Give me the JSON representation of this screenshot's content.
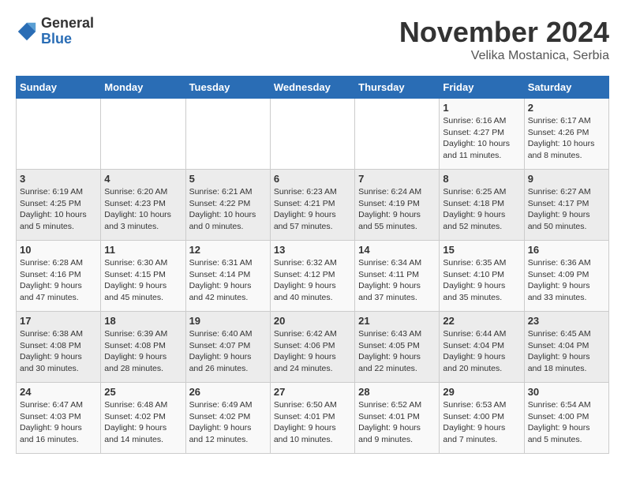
{
  "header": {
    "logo_general": "General",
    "logo_blue": "Blue",
    "month_title": "November 2024",
    "location": "Velika Mostanica, Serbia"
  },
  "weekdays": [
    "Sunday",
    "Monday",
    "Tuesday",
    "Wednesday",
    "Thursday",
    "Friday",
    "Saturday"
  ],
  "weeks": [
    [
      {
        "day": "",
        "info": ""
      },
      {
        "day": "",
        "info": ""
      },
      {
        "day": "",
        "info": ""
      },
      {
        "day": "",
        "info": ""
      },
      {
        "day": "",
        "info": ""
      },
      {
        "day": "1",
        "info": "Sunrise: 6:16 AM\nSunset: 4:27 PM\nDaylight: 10 hours\nand 11 minutes."
      },
      {
        "day": "2",
        "info": "Sunrise: 6:17 AM\nSunset: 4:26 PM\nDaylight: 10 hours\nand 8 minutes."
      }
    ],
    [
      {
        "day": "3",
        "info": "Sunrise: 6:19 AM\nSunset: 4:25 PM\nDaylight: 10 hours\nand 5 minutes."
      },
      {
        "day": "4",
        "info": "Sunrise: 6:20 AM\nSunset: 4:23 PM\nDaylight: 10 hours\nand 3 minutes."
      },
      {
        "day": "5",
        "info": "Sunrise: 6:21 AM\nSunset: 4:22 PM\nDaylight: 10 hours\nand 0 minutes."
      },
      {
        "day": "6",
        "info": "Sunrise: 6:23 AM\nSunset: 4:21 PM\nDaylight: 9 hours\nand 57 minutes."
      },
      {
        "day": "7",
        "info": "Sunrise: 6:24 AM\nSunset: 4:19 PM\nDaylight: 9 hours\nand 55 minutes."
      },
      {
        "day": "8",
        "info": "Sunrise: 6:25 AM\nSunset: 4:18 PM\nDaylight: 9 hours\nand 52 minutes."
      },
      {
        "day": "9",
        "info": "Sunrise: 6:27 AM\nSunset: 4:17 PM\nDaylight: 9 hours\nand 50 minutes."
      }
    ],
    [
      {
        "day": "10",
        "info": "Sunrise: 6:28 AM\nSunset: 4:16 PM\nDaylight: 9 hours\nand 47 minutes."
      },
      {
        "day": "11",
        "info": "Sunrise: 6:30 AM\nSunset: 4:15 PM\nDaylight: 9 hours\nand 45 minutes."
      },
      {
        "day": "12",
        "info": "Sunrise: 6:31 AM\nSunset: 4:14 PM\nDaylight: 9 hours\nand 42 minutes."
      },
      {
        "day": "13",
        "info": "Sunrise: 6:32 AM\nSunset: 4:12 PM\nDaylight: 9 hours\nand 40 minutes."
      },
      {
        "day": "14",
        "info": "Sunrise: 6:34 AM\nSunset: 4:11 PM\nDaylight: 9 hours\nand 37 minutes."
      },
      {
        "day": "15",
        "info": "Sunrise: 6:35 AM\nSunset: 4:10 PM\nDaylight: 9 hours\nand 35 minutes."
      },
      {
        "day": "16",
        "info": "Sunrise: 6:36 AM\nSunset: 4:09 PM\nDaylight: 9 hours\nand 33 minutes."
      }
    ],
    [
      {
        "day": "17",
        "info": "Sunrise: 6:38 AM\nSunset: 4:08 PM\nDaylight: 9 hours\nand 30 minutes."
      },
      {
        "day": "18",
        "info": "Sunrise: 6:39 AM\nSunset: 4:08 PM\nDaylight: 9 hours\nand 28 minutes."
      },
      {
        "day": "19",
        "info": "Sunrise: 6:40 AM\nSunset: 4:07 PM\nDaylight: 9 hours\nand 26 minutes."
      },
      {
        "day": "20",
        "info": "Sunrise: 6:42 AM\nSunset: 4:06 PM\nDaylight: 9 hours\nand 24 minutes."
      },
      {
        "day": "21",
        "info": "Sunrise: 6:43 AM\nSunset: 4:05 PM\nDaylight: 9 hours\nand 22 minutes."
      },
      {
        "day": "22",
        "info": "Sunrise: 6:44 AM\nSunset: 4:04 PM\nDaylight: 9 hours\nand 20 minutes."
      },
      {
        "day": "23",
        "info": "Sunrise: 6:45 AM\nSunset: 4:04 PM\nDaylight: 9 hours\nand 18 minutes."
      }
    ],
    [
      {
        "day": "24",
        "info": "Sunrise: 6:47 AM\nSunset: 4:03 PM\nDaylight: 9 hours\nand 16 minutes."
      },
      {
        "day": "25",
        "info": "Sunrise: 6:48 AM\nSunset: 4:02 PM\nDaylight: 9 hours\nand 14 minutes."
      },
      {
        "day": "26",
        "info": "Sunrise: 6:49 AM\nSunset: 4:02 PM\nDaylight: 9 hours\nand 12 minutes."
      },
      {
        "day": "27",
        "info": "Sunrise: 6:50 AM\nSunset: 4:01 PM\nDaylight: 9 hours\nand 10 minutes."
      },
      {
        "day": "28",
        "info": "Sunrise: 6:52 AM\nSunset: 4:01 PM\nDaylight: 9 hours\nand 9 minutes."
      },
      {
        "day": "29",
        "info": "Sunrise: 6:53 AM\nSunset: 4:00 PM\nDaylight: 9 hours\nand 7 minutes."
      },
      {
        "day": "30",
        "info": "Sunrise: 6:54 AM\nSunset: 4:00 PM\nDaylight: 9 hours\nand 5 minutes."
      }
    ]
  ]
}
